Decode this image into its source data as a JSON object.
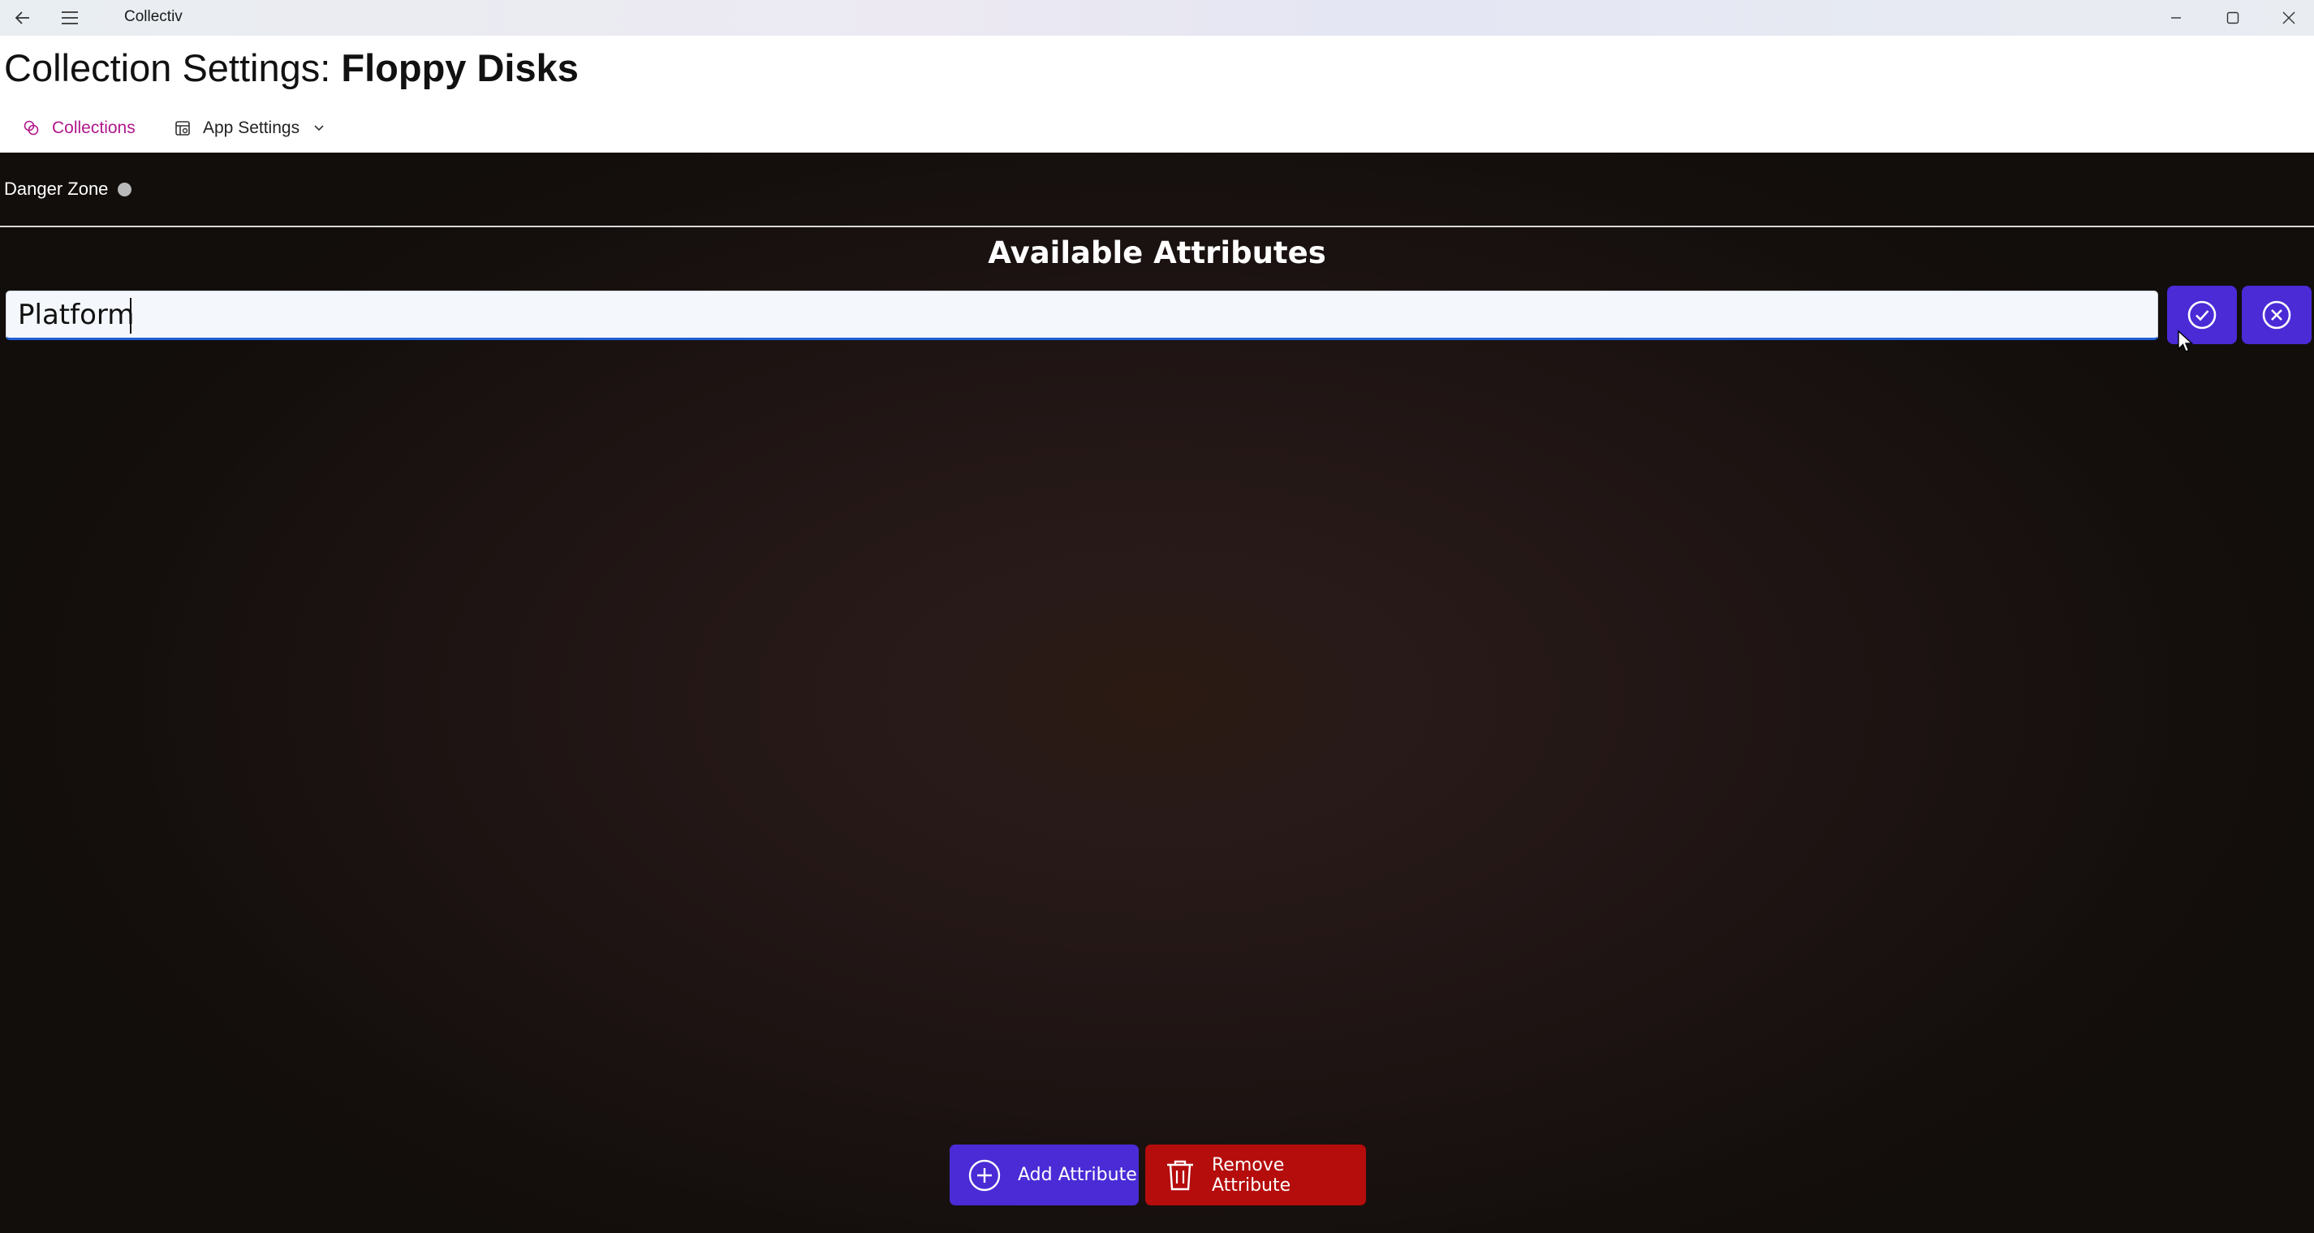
{
  "window": {
    "title": "Collectiv"
  },
  "header": {
    "title_prefix": "Collection Settings: ",
    "collection_name": "Floppy Disks"
  },
  "nav": {
    "items": [
      {
        "label": "Collections",
        "icon": "collections-icon",
        "selected": true
      },
      {
        "label": "App Settings",
        "icon": "app-settings-icon",
        "selected": false,
        "has_dropdown": true
      }
    ],
    "accent_color": "#b0178c"
  },
  "main": {
    "danger_zone_label": "Danger Zone",
    "danger_zone_toggle_on": false,
    "section_title": "Available Attributes",
    "attribute_input": {
      "value": "Platform",
      "placeholder": ""
    },
    "confirm_icon": "check-circle-icon",
    "cancel_icon": "x-circle-icon",
    "add_button_label": "Add Attribute",
    "remove_button_label": "Remove Attribute",
    "primary_color": "#4a2bd6",
    "danger_color": "#b50c0c"
  }
}
